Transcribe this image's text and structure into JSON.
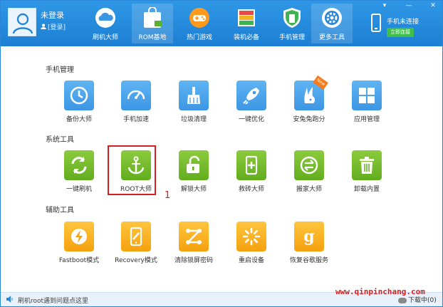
{
  "user": {
    "title": "未登录",
    "link": "[登录]"
  },
  "nav": [
    {
      "label": "刷机大师",
      "icon": "cloud-icon"
    },
    {
      "label": "ROM基地",
      "icon": "shopping-bag-icon"
    },
    {
      "label": "热门游戏",
      "icon": "gamepad-icon"
    },
    {
      "label": "装机必备",
      "icon": "layers-icon"
    },
    {
      "label": "手机管理",
      "icon": "shield-icon"
    },
    {
      "label": "更多工具",
      "icon": "gear-icon"
    }
  ],
  "window_controls": [
    "▾",
    "—",
    "✕"
  ],
  "phone": {
    "status": "手机未连接",
    "connect": "立即连接"
  },
  "sections": [
    {
      "title": "手机管理",
      "tools": [
        {
          "label": "备份大师",
          "icon": "backup-icon"
        },
        {
          "label": "手机加速",
          "icon": "speedometer-icon"
        },
        {
          "label": "垃圾清理",
          "icon": "broom-icon"
        },
        {
          "label": "一键优化",
          "icon": "rocket-icon"
        },
        {
          "label": "安兔兔跑分",
          "icon": "rabbit-icon",
          "badge": "New"
        },
        {
          "label": "应用管理",
          "icon": "apps-grid-icon"
        }
      ]
    },
    {
      "title": "系统工具",
      "tools": [
        {
          "label": "一键刷机",
          "icon": "refresh-icon"
        },
        {
          "label": "ROOT大师",
          "icon": "anchor-icon"
        },
        {
          "label": "解锁大师",
          "icon": "unlock-icon"
        },
        {
          "label": "救砖大师",
          "icon": "phone-plus-icon"
        },
        {
          "label": "搬家大师",
          "icon": "transfer-icon"
        },
        {
          "label": "卸载内置",
          "icon": "trash-icon"
        }
      ]
    },
    {
      "title": "辅助工具",
      "tools": [
        {
          "label": "Fastboot模式",
          "icon": "lightning-icon"
        },
        {
          "label": "Recovery模式",
          "icon": "phone-recovery-icon"
        },
        {
          "label": "清除锁屏密码",
          "icon": "pattern-lock-icon"
        },
        {
          "label": "重启设备",
          "icon": "loading-icon"
        },
        {
          "label": "恢复谷歌服务",
          "icon": "google-g-icon"
        }
      ]
    }
  ],
  "annotation": "1",
  "status": {
    "text": "刷机root遇到问题点这里",
    "download": "下载中(0)"
  },
  "watermark": "www.qinpinchang.com",
  "colors": {
    "titlebar": "#1d7fd3",
    "blue_tile": "#3d96e4",
    "green_tile": "#62ad1e",
    "orange_tile": "#f5a10e",
    "highlight": "#d81f1f"
  }
}
